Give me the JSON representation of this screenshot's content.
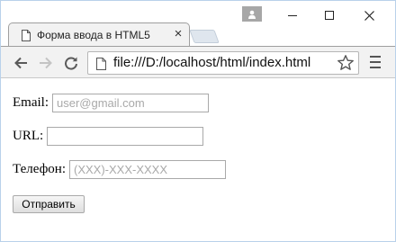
{
  "browser": {
    "tab": {
      "title": "Форма ввода в HTML5",
      "close_glyph": "×"
    },
    "address_bar": {
      "url": "file:///D:/localhost/html/index.html"
    },
    "icons": [
      "profile-icon",
      "minimize-icon",
      "maximize-icon",
      "close-icon",
      "document-icon",
      "back-arrow-icon",
      "forward-arrow-icon",
      "reload-icon",
      "bookmark-star-icon",
      "menu-icon"
    ]
  },
  "form": {
    "email": {
      "label": "Email:",
      "value": "",
      "placeholder": "user@gmail.com"
    },
    "url": {
      "label": "URL:",
      "value": "",
      "placeholder": ""
    },
    "phone": {
      "label": "Телефон:",
      "value": "",
      "placeholder": "(XXX)-XXX-XXXX"
    },
    "submit_label": "Отправить"
  },
  "colors": {
    "window_border": "#b9d1ea",
    "toolbar_bg": "#f2f2f2",
    "placeholder": "#a9a9a9"
  }
}
